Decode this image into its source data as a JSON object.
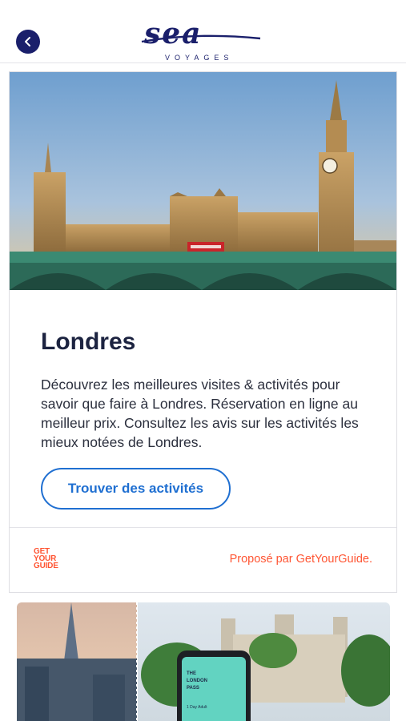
{
  "header": {
    "back_icon": "chevron-left-icon",
    "logo_text": "sea",
    "logo_subtext": "VOYAGES"
  },
  "card": {
    "title": "Londres",
    "description": "Découvrez les meilleures visites & activités pour savoir que faire à Londres. Réservation en ligne au meilleur prix. Consultez les avis sur les activités les mieux notées de Londres.",
    "cta_label": "Trouver des activités",
    "partner_logo": [
      "GET",
      "YOUR",
      "GUIDE"
    ],
    "provider_text": "Proposé par GetYourGuide."
  },
  "promo": {
    "pass_lines": [
      "THE",
      "LONDON",
      "PASS"
    ],
    "pass_sub": "1 Day Adult"
  },
  "colors": {
    "navy": "#1a1f6b",
    "accent_blue": "#1f6fd1",
    "gyg_orange": "#ff5533"
  }
}
